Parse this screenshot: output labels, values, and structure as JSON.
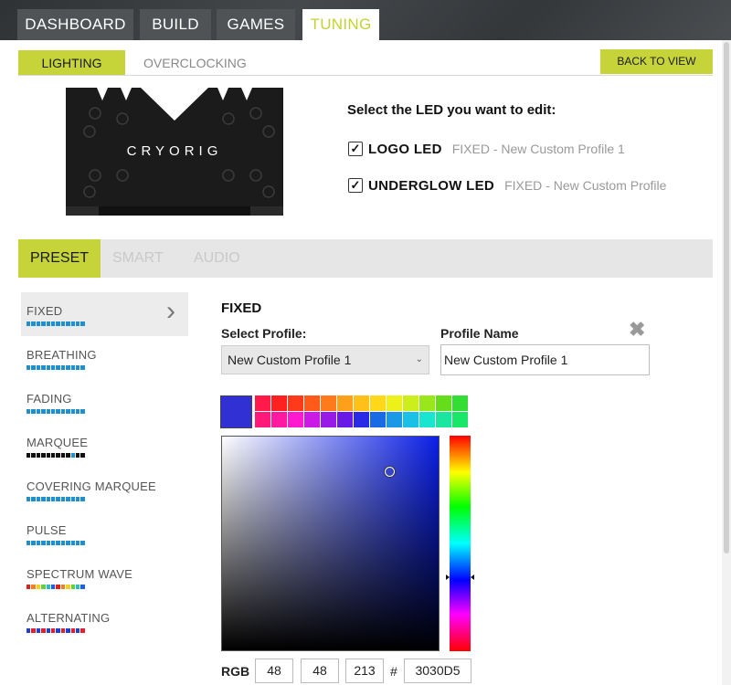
{
  "top_tabs": [
    {
      "label": "DASHBOARD",
      "active": false
    },
    {
      "label": "BUILD",
      "active": false
    },
    {
      "label": "GAMES",
      "active": false
    },
    {
      "label": "TUNING",
      "active": true
    }
  ],
  "sub_tabs": [
    {
      "label": "LIGHTING",
      "active": true
    },
    {
      "label": "OVERCLOCKING",
      "active": false
    }
  ],
  "back_button": "BACK TO VIEW",
  "cooler_brand": "CRYORIG",
  "led_section": {
    "title": "Select the LED you want to edit:",
    "leds": [
      {
        "name": "LOGO LED",
        "checked": true,
        "profile": "FIXED - New Custom Profile 1"
      },
      {
        "name": "UNDERGLOW LED",
        "checked": true,
        "profile": "FIXED - New Custom Profile"
      }
    ]
  },
  "mode_tabs": [
    {
      "label": "PRESET",
      "active": true
    },
    {
      "label": "SMART",
      "active": false
    },
    {
      "label": "AUDIO",
      "active": false
    }
  ],
  "effects": [
    {
      "label": "FIXED",
      "active": true,
      "swatch": [
        "#1f8fd0"
      ]
    },
    {
      "label": "BREATHING",
      "active": false,
      "swatch": [
        "#1f8fd0"
      ]
    },
    {
      "label": "FADING",
      "active": false,
      "swatch": [
        "#1f8fd0"
      ]
    },
    {
      "label": "MARQUEE",
      "active": false,
      "swatch": [
        "#111111",
        "#1f8fd0"
      ]
    },
    {
      "label": "COVERING MARQUEE",
      "active": false,
      "swatch": [
        "#1f8fd0"
      ]
    },
    {
      "label": "PULSE",
      "active": false,
      "swatch": [
        "#1f8fd0"
      ]
    },
    {
      "label": "SPECTRUM WAVE",
      "active": false,
      "swatch": [
        "#e02020",
        "#f08020",
        "#f0d020",
        "#60d040",
        "#20c0c0",
        "#2060e0"
      ]
    },
    {
      "label": "ALTERNATING",
      "active": false,
      "swatch": [
        "#2040d0",
        "#e02030"
      ]
    }
  ],
  "detail": {
    "title": "FIXED",
    "select_profile_label": "Select Profile:",
    "select_profile_value": "New Custom Profile 1",
    "profile_name_label": "Profile Name",
    "profile_name_value": "New Custom Profile 1",
    "current_color": "#3030D5",
    "palette": [
      "#ff1a4a",
      "#ff2020",
      "#ff3a1a",
      "#ff5a1a",
      "#ff7a1a",
      "#ffa01a",
      "#ffc01a",
      "#ffd81a",
      "#eef01a",
      "#ccee1a",
      "#99e61a",
      "#66dd1a",
      "#33dd33",
      "#ff1a7a",
      "#ff1aa0",
      "#ff1ad0",
      "#cc1ae6",
      "#991ae6",
      "#6a1ae6",
      "#2a2ae6",
      "#1a6ae6",
      "#1a9ae6",
      "#1ac0e6",
      "#1ae6d0",
      "#1ae6a0",
      "#1ae66a"
    ],
    "hue_color": "#0a1fe6",
    "rgb": {
      "label": "RGB",
      "r": "48",
      "g": "48",
      "b": "213",
      "hash_label": "#",
      "hex": "3030D5"
    }
  }
}
